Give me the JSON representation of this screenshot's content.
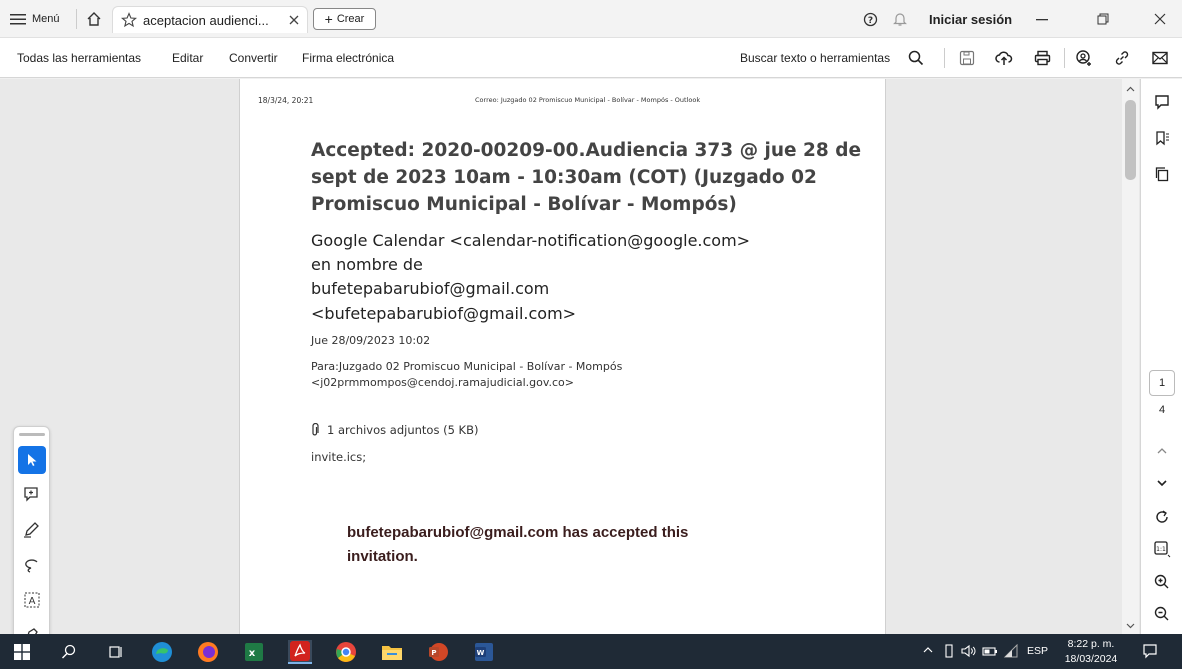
{
  "titlebar": {
    "menu_label": "Menú",
    "tab_title": "aceptacion audienci...",
    "crear_label": "Crear",
    "signin_label": "Iniciar sesión"
  },
  "toolbar": {
    "items": [
      "Todas las herramientas",
      "Editar",
      "Convertir",
      "Firma electrónica"
    ],
    "search_label": "Buscar texto o herramientas"
  },
  "document": {
    "header_date": "18/3/24, 20:21",
    "header_source": "Correo: Juzgado 02 Promiscuo Municipal - Bolívar - Mompós - Outlook",
    "subject_lines": [
      "Accepted: 2020-00209-00.Audiencia 373 @ jue 28 de",
      "sept de 2023 10am - 10:30am (COT) (Juzgado 02",
      "Promiscuo Municipal - Bolívar - Mompós)"
    ],
    "sender_lines": [
      "Google Calendar <calendar-notification@google.com>",
      "en nombre de",
      "bufetepabarubiof@gmail.com",
      "<bufetepabarubiof@gmail.com>"
    ],
    "date": "Jue 28/09/2023 10:02",
    "to_line1": "Para:Juzgado 02 Promiscuo Municipal - Bolívar - Mompós",
    "to_line2": "<j02prmmompos@cendoj.ramajudicial.gov.co>",
    "attachments": "1 archivos adjuntos (5 KB)",
    "attachment_file": "invite.ics;",
    "body_line1": "bufetepabarubiof@gmail.com has accepted this",
    "body_line2": "invitation."
  },
  "pages": {
    "current": "1",
    "total": "4"
  },
  "taskbar": {
    "lang": "ESP",
    "time": "8:22 p. m.",
    "date": "18/03/2024"
  }
}
